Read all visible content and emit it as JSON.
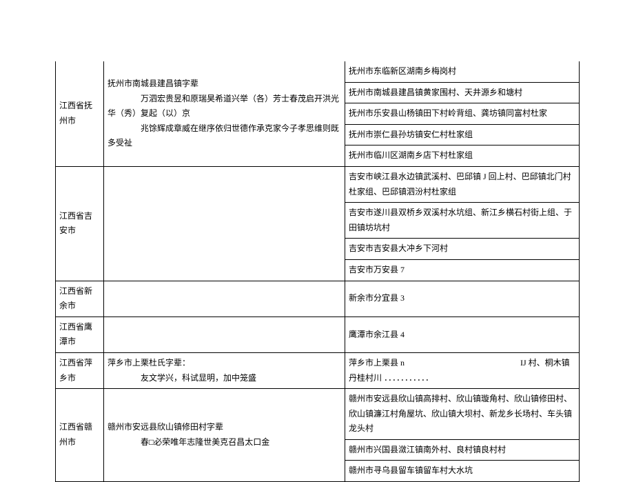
{
  "rows": [
    {
      "region": "江西省抚州市",
      "middle": "抚州市南城县建昌镇字辈\n万泗宏贵昱和原瑞昊希道兴举（各）芳士春茂启开洪光华（秀）复起（以）京\n兆馀辉成章威在继序依归世德作承克家今子孝思维则既多受祉",
      "rights": [
        "抚州市东临新区湖南乡梅岗村",
        "抚州市南城县建昌镇黄家围村、天井源乡和塘村",
        "抚州市乐安县山杨镇田下村岭背组、龚坊镇同富村杜家",
        "抚州市崇仁县孙坊镇安仁村杜家组",
        "抚州市临川区湖南乡店下村杜家组"
      ]
    },
    {
      "region": "江西省吉安市",
      "middle": "",
      "rights": [
        "吉安市峡江县水边镇武溪村、巴邱镇 J 回上村、巴邱镇北门村杜家组、巴邱镇泗汾村杜家组",
        "吉安市遂川县双桥乡双溪村水坑组、新江乡横石村街上组、于田镇坊坑村",
        "吉安市吉安县大冲乡下河村",
        "吉安市万安县 7"
      ]
    },
    {
      "region": "江西省新余市",
      "middle": "",
      "rights": [
        "新余市分宜县 3"
      ]
    },
    {
      "region": "江西省鹰潭市",
      "middle": "",
      "rights": [
        "鹰潭市余江县 4"
      ]
    },
    {
      "region": "江西省萍乡市",
      "middle": "萍乡市上栗杜氏字辈：\n友文学兴，科试显明，加中笼盛",
      "rights": [
        "萍乡市上栗县 n　　　　　　　　　　　　　　IJ 村、桐木镇丹桂村川 ．．．．．．．．．．．",
        ""
      ]
    },
    {
      "region": "江西省赣州市",
      "middle": "赣州市安远县欣山镇修田村字辈\n春□必荣唯年志隆世美克召昌太口金",
      "rights": [
        "赣州市安远县欣山镇高排村、欣山镇璇角村、欣山镇修田村、欣山镇濂江村角屋坑、欣山镇大坝村、新龙乡长场村、车头镇龙头村",
        "赣州市兴国县潋江镇南外村、良村镇良村村",
        "赣州市寻乌县留车镇留车村大水坑"
      ]
    }
  ]
}
